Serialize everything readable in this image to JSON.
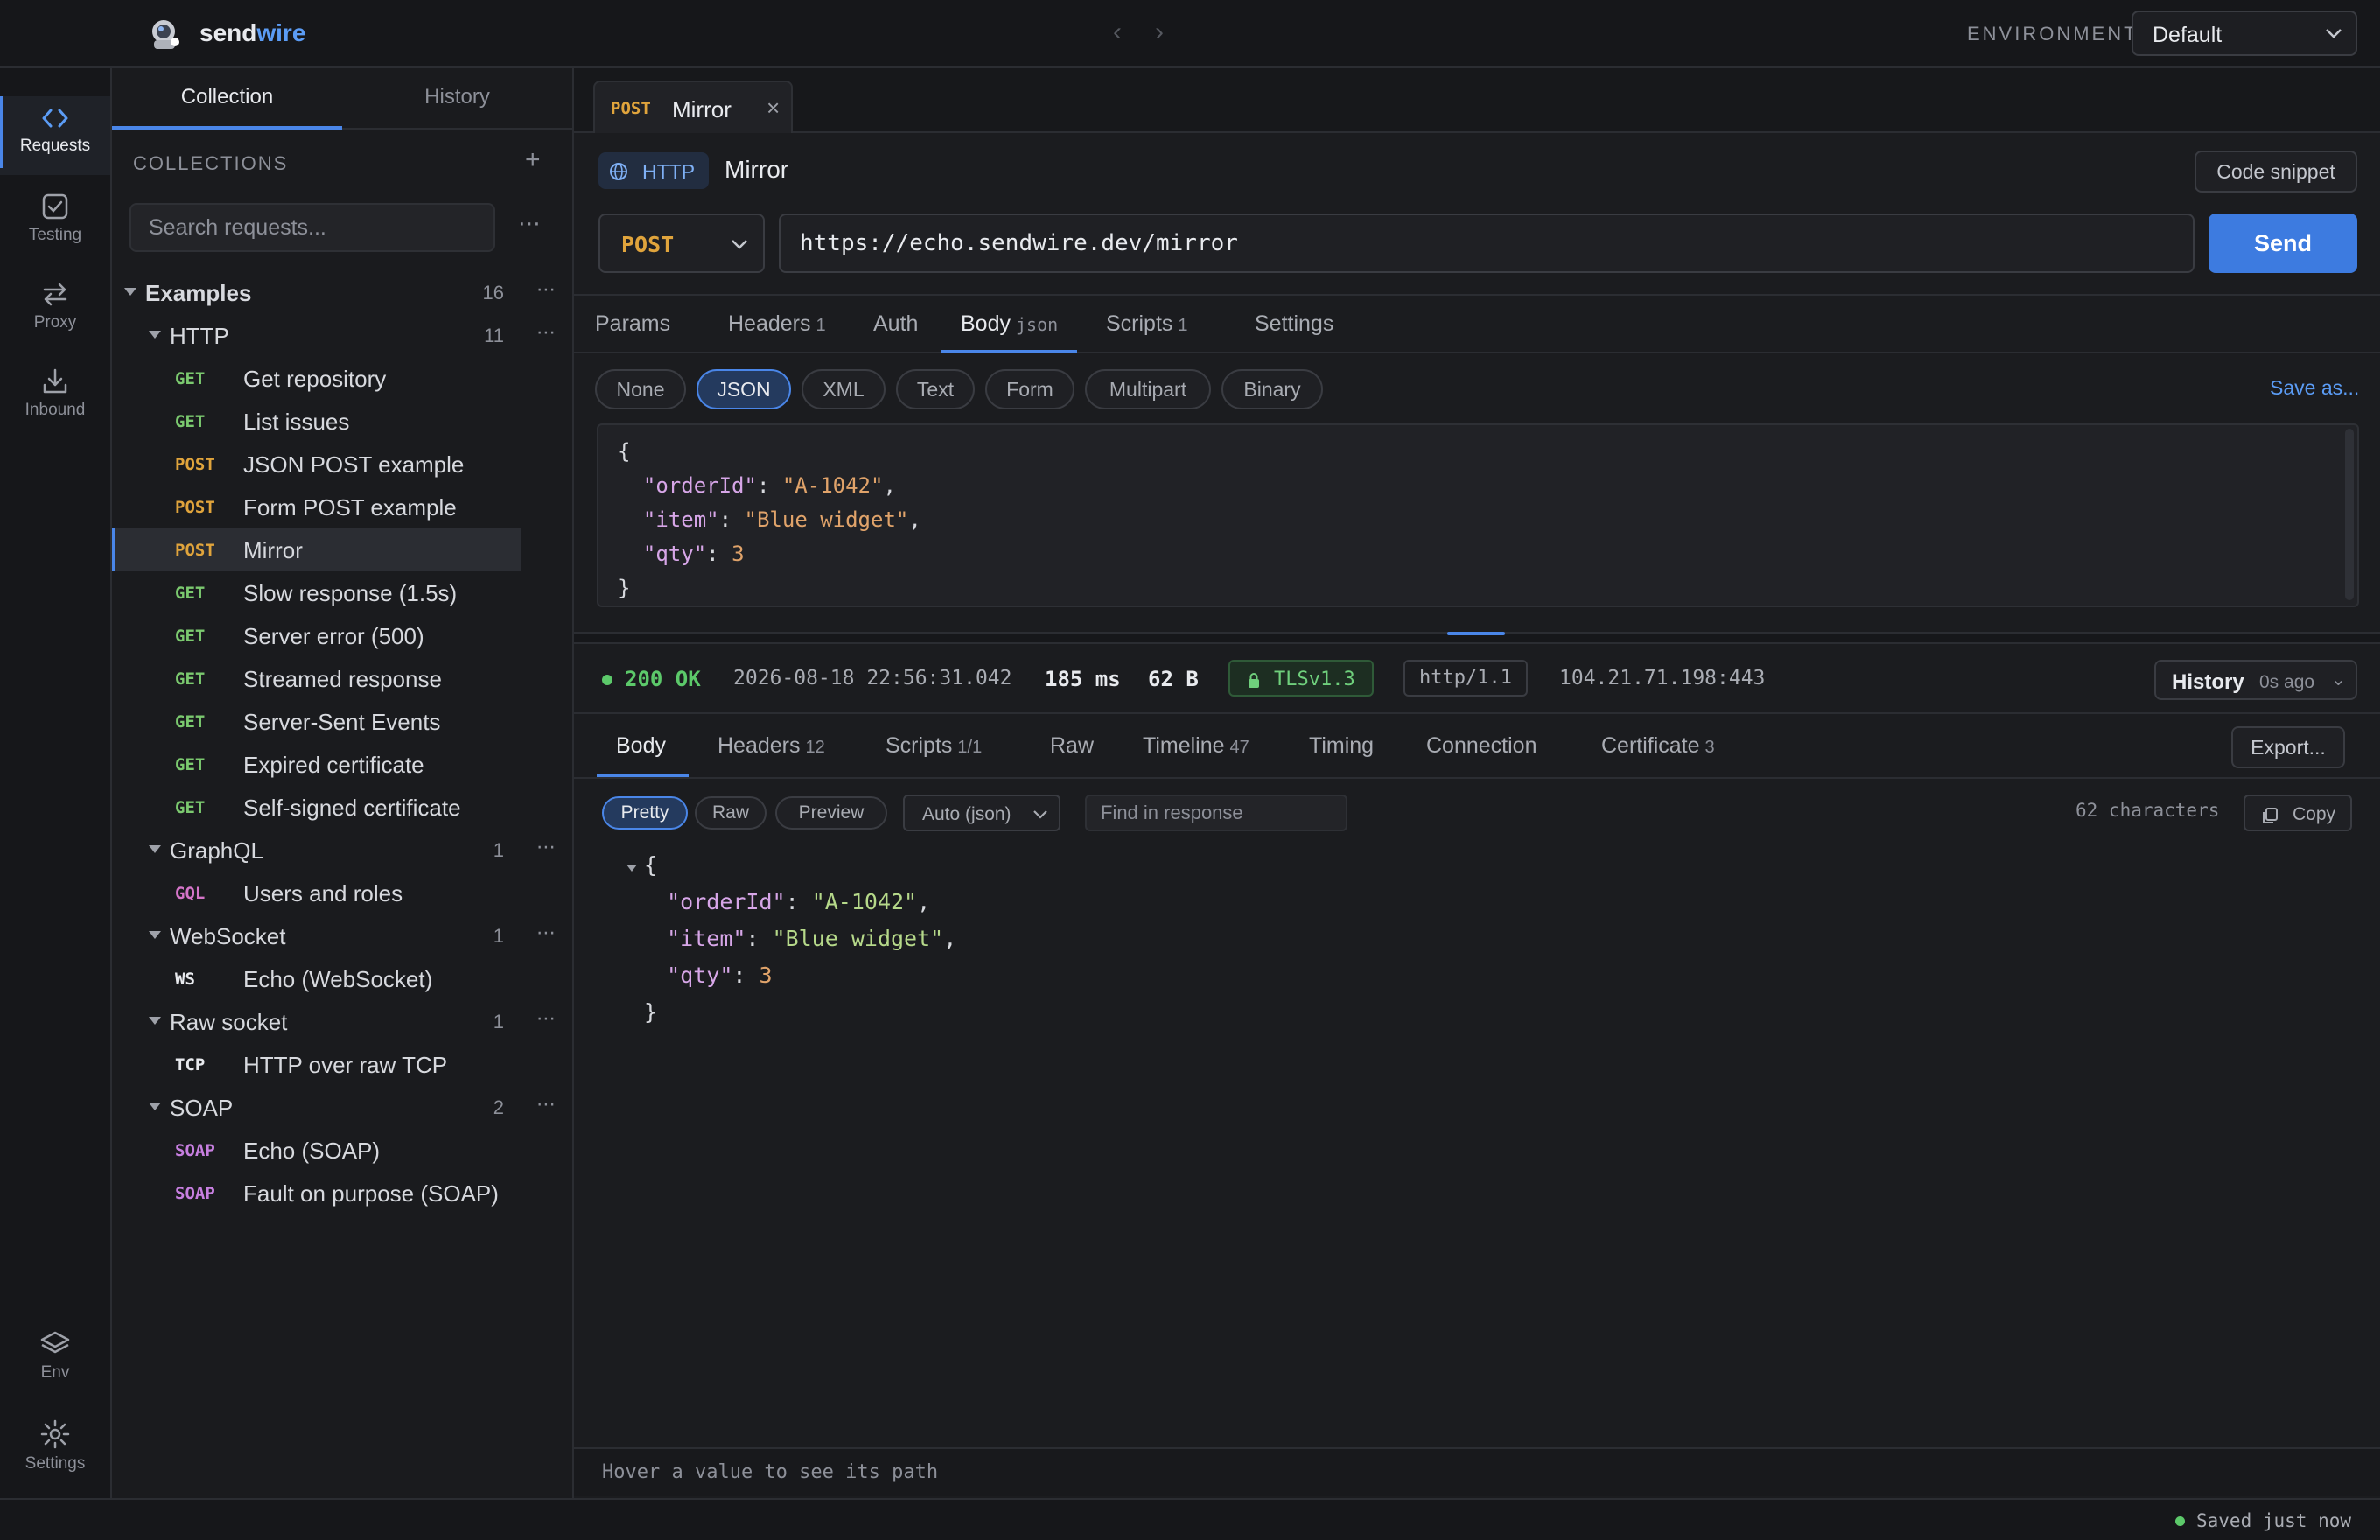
{
  "app": {
    "brand_prefix": "send",
    "brand_suffix": "wire",
    "nav_back": "‹",
    "nav_forward": "›"
  },
  "environment": {
    "label": "ENVIRONMENT",
    "value": "Default"
  },
  "rail": {
    "items": [
      {
        "label": "Requests",
        "icon": "code-brackets-icon",
        "active": true
      },
      {
        "label": "Testing",
        "icon": "checkbox-icon"
      },
      {
        "label": "Proxy",
        "icon": "swap-arrows-icon"
      },
      {
        "label": "Inbound",
        "icon": "download-icon"
      }
    ],
    "bottom": [
      {
        "label": "Env",
        "icon": "layers-icon"
      },
      {
        "label": "Settings",
        "icon": "gear-icon"
      }
    ]
  },
  "sidebar": {
    "tabs": [
      "Collection",
      "History"
    ],
    "active_tab": "Collection",
    "collections_heading": "COLLECTIONS",
    "add": "+",
    "search_placeholder": "Search requests...",
    "more": "⋯",
    "tree": [
      {
        "type": "folder",
        "level": 0,
        "name": "Examples",
        "count": "16"
      },
      {
        "type": "folder",
        "level": 1,
        "name": "HTTP",
        "count": "11"
      },
      {
        "type": "req",
        "method": "GET",
        "name": "Get repository"
      },
      {
        "type": "req",
        "method": "GET",
        "name": "List issues"
      },
      {
        "type": "req",
        "method": "POST",
        "name": "JSON POST example"
      },
      {
        "type": "req",
        "method": "POST",
        "name": "Form POST example"
      },
      {
        "type": "req",
        "method": "POST",
        "name": "Mirror",
        "selected": true
      },
      {
        "type": "req",
        "method": "GET",
        "name": "Slow response (1.5s)"
      },
      {
        "type": "req",
        "method": "GET",
        "name": "Server error (500)"
      },
      {
        "type": "req",
        "method": "GET",
        "name": "Streamed response"
      },
      {
        "type": "req",
        "method": "GET",
        "name": "Server-Sent Events"
      },
      {
        "type": "req",
        "method": "GET",
        "name": "Expired certificate"
      },
      {
        "type": "req",
        "method": "GET",
        "name": "Self-signed certificate"
      },
      {
        "type": "folder",
        "level": 1,
        "name": "GraphQL",
        "count": "1"
      },
      {
        "type": "req",
        "method": "GQL",
        "name": "Users and roles"
      },
      {
        "type": "folder",
        "level": 1,
        "name": "WebSocket",
        "count": "1"
      },
      {
        "type": "req",
        "method": "WS",
        "name": "Echo (WebSocket)"
      },
      {
        "type": "folder",
        "level": 1,
        "name": "Raw socket",
        "count": "1"
      },
      {
        "type": "req",
        "method": "TCP",
        "name": "HTTP over raw TCP"
      },
      {
        "type": "folder",
        "level": 1,
        "name": "SOAP",
        "count": "2"
      },
      {
        "type": "req",
        "method": "SOAP",
        "name": "Echo (SOAP)"
      },
      {
        "type": "req",
        "method": "SOAP",
        "name": "Fault on purpose (SOAP)"
      }
    ]
  },
  "request_tab": {
    "method": "POST",
    "title": "Mirror",
    "close": "×"
  },
  "request": {
    "protocol": "HTTP",
    "title": "Mirror",
    "code_snippet": "Code snippet",
    "method": "POST",
    "url": "https://echo.sendwire.dev/mirror",
    "send": "Send",
    "tabs": [
      {
        "label": "Params",
        "sub": ""
      },
      {
        "label": "Headers",
        "sub": "1"
      },
      {
        "label": "Auth",
        "sub": ""
      },
      {
        "label": "Body",
        "sub": "json",
        "active": true
      },
      {
        "label": "Scripts",
        "sub": "1"
      },
      {
        "label": "Settings",
        "sub": ""
      }
    ],
    "body_types": [
      "None",
      "JSON",
      "XML",
      "Text",
      "Form",
      "Multipart",
      "Binary"
    ],
    "active_body_type": "JSON",
    "save_as": "Save as...",
    "body_lines": [
      [
        [
          "p",
          "{"
        ]
      ],
      [
        [
          "p",
          "  "
        ],
        [
          "k",
          "\"orderId\""
        ],
        [
          "p",
          ": "
        ],
        [
          "s",
          "\"A-1042\""
        ],
        [
          "p",
          ","
        ]
      ],
      [
        [
          "p",
          "  "
        ],
        [
          "k",
          "\"item\""
        ],
        [
          "p",
          ": "
        ],
        [
          "s",
          "\"Blue widget\""
        ],
        [
          "p",
          ","
        ]
      ],
      [
        [
          "p",
          "  "
        ],
        [
          "k",
          "\"qty\""
        ],
        [
          "p",
          ": "
        ],
        [
          "n",
          "3"
        ]
      ],
      [
        [
          "p",
          "}"
        ]
      ]
    ]
  },
  "response": {
    "status": "200 OK",
    "timestamp": "2026-08-18 22:56:31.042",
    "duration": "185 ms",
    "size": "62 B",
    "tls": "TLSv1.3",
    "http_version": "http/1.1",
    "remote": "104.21.71.198:443",
    "history_label": "History",
    "history_ago": "0s ago",
    "history_chevron": "⌄",
    "tabs": [
      {
        "label": "Body",
        "sub": "",
        "active": true
      },
      {
        "label": "Headers",
        "sub": "12"
      },
      {
        "label": "Scripts",
        "sub": "1/1"
      },
      {
        "label": "Raw",
        "sub": ""
      },
      {
        "label": "Timeline",
        "sub": "47"
      },
      {
        "label": "Timing",
        "sub": ""
      },
      {
        "label": "Connection",
        "sub": ""
      },
      {
        "label": "Certificate",
        "sub": "3"
      }
    ],
    "export": "Export...",
    "views": [
      "Pretty",
      "Raw",
      "Preview"
    ],
    "active_view": "Pretty",
    "format": "Auto (json)",
    "find_placeholder": "Find in response",
    "char_count": "62 characters",
    "copy": "Copy",
    "body_lines": [
      [
        [
          "p",
          "{"
        ]
      ],
      [
        [
          "p",
          "  "
        ],
        [
          "k",
          "\"orderId\""
        ],
        [
          "p",
          ": "
        ],
        [
          "s",
          "\"A-1042\""
        ],
        [
          "p",
          ","
        ]
      ],
      [
        [
          "p",
          "  "
        ],
        [
          "k",
          "\"item\""
        ],
        [
          "p",
          ": "
        ],
        [
          "s",
          "\"Blue widget\""
        ],
        [
          "p",
          ","
        ]
      ],
      [
        [
          "p",
          "  "
        ],
        [
          "k",
          "\"qty\""
        ],
        [
          "p",
          ": "
        ],
        [
          "n",
          "3"
        ]
      ],
      [
        [
          "p",
          "}"
        ]
      ]
    ],
    "hover_hint": "Hover a value to see its path"
  },
  "footer": {
    "saved": "Saved just now"
  },
  "colors": {
    "accent": "#4a86e8",
    "send_button": "#3d7be0",
    "get": "#7bc96f",
    "post": "#e0a43c",
    "gql": "#d575c9",
    "soap": "#c77fe0",
    "ok": "#5cc96a",
    "json_key": "#d7a6e8",
    "json_string": "#e0a36a",
    "json_key_resp": "#d7a6e8",
    "json_string_resp": "#b6d98a",
    "json_number_resp": "#e0a36a"
  }
}
